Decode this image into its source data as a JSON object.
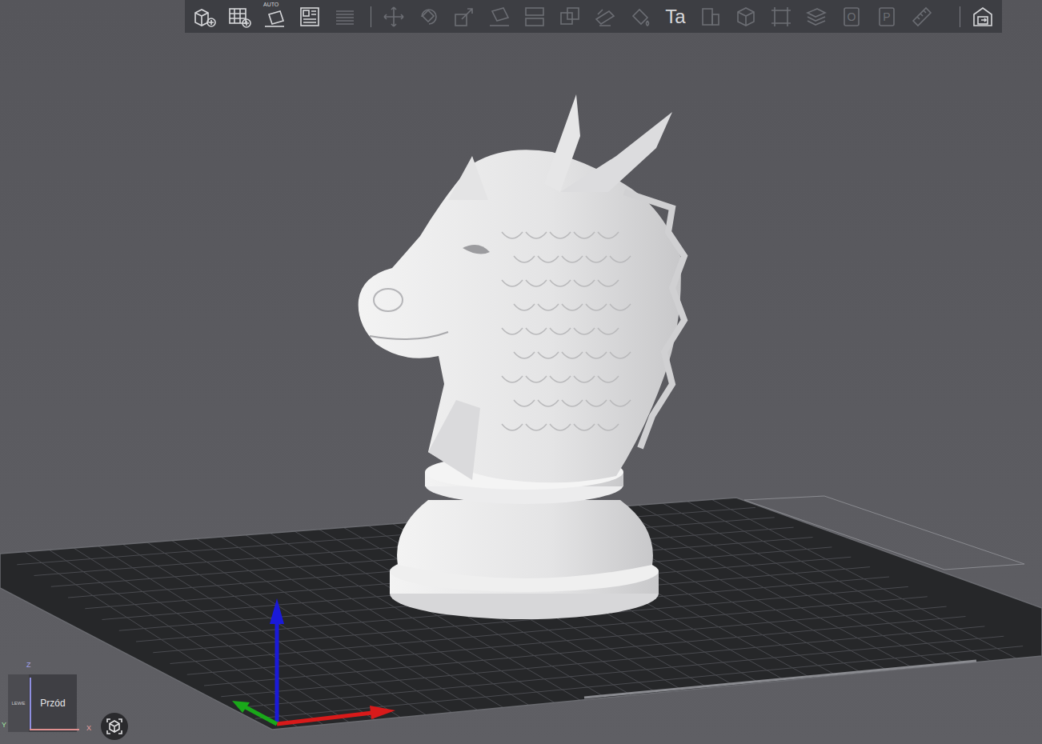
{
  "toolbar": {
    "groups": [
      [
        {
          "kind": "add",
          "label": "",
          "disabled": false
        },
        {
          "kind": "add-plate",
          "label": "",
          "disabled": false
        },
        {
          "kind": "auto-arrange",
          "label": "AUTO",
          "disabled": false
        },
        {
          "kind": "arrange",
          "label": "",
          "disabled": false
        },
        {
          "kind": "layers",
          "label": "",
          "disabled": true
        }
      ],
      [
        {
          "kind": "move",
          "label": "",
          "disabled": true
        },
        {
          "kind": "rotate",
          "label": "",
          "disabled": true
        },
        {
          "kind": "scale",
          "label": "",
          "disabled": true
        },
        {
          "kind": "lay-on-face",
          "label": "",
          "disabled": true
        },
        {
          "kind": "split",
          "label": "",
          "disabled": true
        },
        {
          "kind": "cut",
          "label": "",
          "disabled": true
        },
        {
          "kind": "support-paint",
          "label": "",
          "disabled": true
        },
        {
          "kind": "color-paint",
          "label": "",
          "disabled": true
        },
        {
          "kind": "text",
          "label": "Ta",
          "disabled": false
        },
        {
          "kind": "square",
          "label": "",
          "disabled": true
        },
        {
          "kind": "cube",
          "label": "",
          "disabled": true
        },
        {
          "kind": "crop",
          "label": "",
          "disabled": true
        },
        {
          "kind": "stack",
          "label": "",
          "disabled": true
        },
        {
          "kind": "letter",
          "label": "O",
          "disabled": true
        },
        {
          "kind": "letter",
          "label": "P",
          "disabled": true
        },
        {
          "kind": "ruler",
          "label": "",
          "disabled": true
        }
      ],
      [
        {
          "kind": "plate-export",
          "label": "",
          "disabled": false
        }
      ]
    ]
  },
  "view_cube": {
    "front": "Przód",
    "left": "LEWE",
    "axes": [
      "Z",
      "X",
      "Y"
    ]
  }
}
